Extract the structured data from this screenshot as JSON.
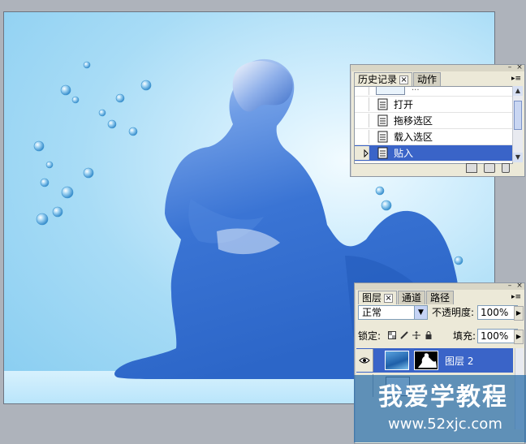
{
  "history_panel": {
    "tabs": [
      {
        "label": "历史记录",
        "active": true
      },
      {
        "label": "动作",
        "active": false
      }
    ],
    "partial_item": "...",
    "items": [
      {
        "label": "打开",
        "selected": false
      },
      {
        "label": "拖移选区",
        "selected": false
      },
      {
        "label": "载入选区",
        "selected": false
      },
      {
        "label": "贴入",
        "selected": true
      }
    ],
    "footer_icons": [
      "new-document-icon",
      "snapshot-icon",
      "trash-icon"
    ]
  },
  "layers_panel": {
    "tabs": [
      {
        "label": "图层",
        "active": true
      },
      {
        "label": "通道",
        "active": false
      },
      {
        "label": "路径",
        "active": false
      }
    ],
    "blend_mode": "正常",
    "opacity_label": "不透明度:",
    "opacity_value": "100%",
    "lock_label": "锁定:",
    "fill_label": "填充:",
    "fill_value": "100%",
    "layers": [
      {
        "name": "图层 2",
        "selected": true,
        "visible": true
      }
    ]
  },
  "watermark": {
    "title": "我爱学教程",
    "url": "www.52xjc.com"
  },
  "colors": {
    "selection": "#3a64c8",
    "panel_bg": "#ece9d8",
    "canvas_sky": "#a8dcf6",
    "figure_blue": "#2f6fce"
  }
}
